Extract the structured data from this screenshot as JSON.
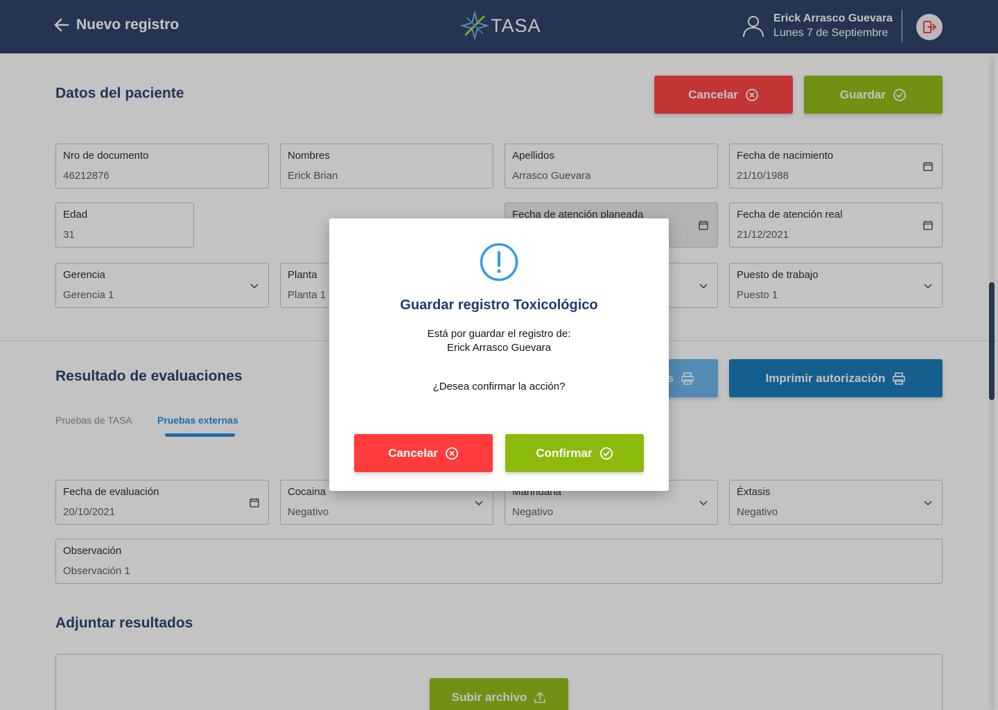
{
  "header": {
    "title": "Nuevo registro",
    "logo_text": "TASA",
    "user_name": "Erick Arrasco Guevara",
    "date": "Lunes 7 de Septiembre"
  },
  "patient": {
    "title": "Datos del paciente",
    "cancel_label": "Cancelar",
    "save_label": "Guardar",
    "fields": {
      "document": {
        "label": "Nro de documento",
        "value": "46212876"
      },
      "names": {
        "label": "Nombres",
        "value": "Erick Brian"
      },
      "surnames": {
        "label": "Apellidos",
        "value": "Arrasco Guevara"
      },
      "birthdate": {
        "label": "Fecha de nacimiento",
        "value": "21/10/1988"
      },
      "age": {
        "label": "Edad",
        "value": "31"
      },
      "planned_date": {
        "label": "Fecha de atención planeada",
        "value": ""
      },
      "real_date": {
        "label": "Fecha de atención real",
        "value": "21/12/2021"
      },
      "management": {
        "label": "Gerencia",
        "value": "Gerencia 1"
      },
      "plant": {
        "label": "Planta",
        "value": "Planta 1"
      },
      "job": {
        "label": "Puesto de trabajo",
        "value": "Puesto 1"
      }
    }
  },
  "results": {
    "title": "Resultado de evaluaciones",
    "print_partial_label": "s",
    "print_auth_label": "Imprimir autorización",
    "tabs": [
      {
        "label": "Pruebas de TASA",
        "active": false
      },
      {
        "label": "Pruebas externas",
        "active": true
      }
    ],
    "fields": {
      "eval_date": {
        "label": "Fecha de evaluación",
        "value": "20/10/2021"
      },
      "cocaine": {
        "label": "Cocaina",
        "value": "Negativo"
      },
      "marijuana": {
        "label": "Marihuana",
        "value": "Negativo"
      },
      "ecstasy": {
        "label": "Éxtasis",
        "value": "Negativo"
      },
      "observation": {
        "label": "Observación",
        "value": "Observación 1"
      }
    }
  },
  "attachments": {
    "title": "Adjuntar resultados",
    "upload_label": "Subir archivo"
  },
  "modal": {
    "title": "Guardar registro Toxicológico",
    "line1": "Está por guardar el registro de:",
    "line2": "Erick Arrasco Guevara",
    "question": "¿Desea confirmar la acción?",
    "cancel_label": "Cancelar",
    "confirm_label": "Confirmar"
  },
  "colors": {
    "header": "#243a63",
    "title": "#1f3a6b",
    "red": "#ff3b3b",
    "green": "#8cba0d",
    "blue": "#0f75b8",
    "info": "#2e9cf0"
  },
  "icons": [
    "back-arrow-icon",
    "tasa-logo-icon",
    "user-icon",
    "logout-icon",
    "cancel-circle-icon",
    "check-circle-icon",
    "calendar-icon",
    "chevron-down-icon",
    "print-icon",
    "upload-icon",
    "alert-icon"
  ]
}
